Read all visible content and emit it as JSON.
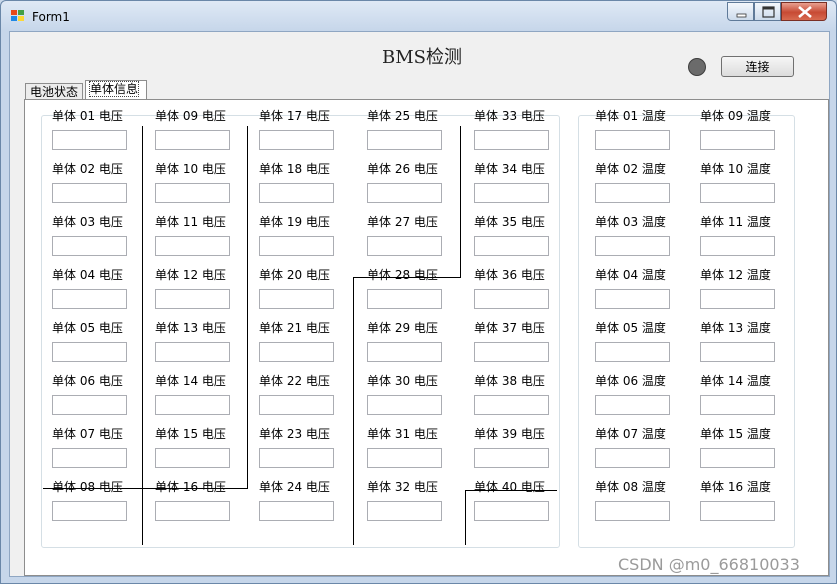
{
  "window": {
    "title": "Form1"
  },
  "header": {
    "title": "BMS检测",
    "connect_label": "连接"
  },
  "tabs": [
    {
      "label": "电池状态"
    },
    {
      "label": "单体信息"
    }
  ],
  "voltage_cells": [
    "单体 01 电压",
    "单体 02 电压",
    "单体 03 电压",
    "单体 04 电压",
    "单体 05 电压",
    "单体 06 电压",
    "单体 07 电压",
    "单体 08 电压",
    "单体 09 电压",
    "单体 10 电压",
    "单体 11 电压",
    "单体 12 电压",
    "单体 13 电压",
    "单体 14 电压",
    "单体 15 电压",
    "单体 16 电压",
    "单体 17 电压",
    "单体 18 电压",
    "单体 19 电压",
    "单体 20 电压",
    "单体 21 电压",
    "单体 22 电压",
    "单体 23 电压",
    "单体 24 电压",
    "单体 25 电压",
    "单体 26 电压",
    "单体 27 电压",
    "单体 28 电压",
    "单体 29 电压",
    "单体 30 电压",
    "单体 31 电压",
    "单体 32 电压",
    "单体 33 电压",
    "单体 34 电压",
    "单体 35 电压",
    "单体 36 电压",
    "单体 37 电压",
    "单体 38 电压",
    "单体 39 电压",
    "单体 40 电压"
  ],
  "temperature_cells": [
    "单体 01 温度",
    "单体 02 温度",
    "单体 03 温度",
    "单体 04 温度",
    "单体 05 温度",
    "单体 06 温度",
    "单体 07 温度",
    "单体 08 温度",
    "单体 09 温度",
    "单体 10 温度",
    "单体 11 温度",
    "单体 12 温度",
    "单体 13 温度",
    "单体 14 温度",
    "单体 15 温度",
    "单体 16 温度"
  ],
  "watermark": "CSDN @m0_66810033",
  "colors": {
    "led": "#6b6b6b",
    "close_button": "#c74a34"
  }
}
